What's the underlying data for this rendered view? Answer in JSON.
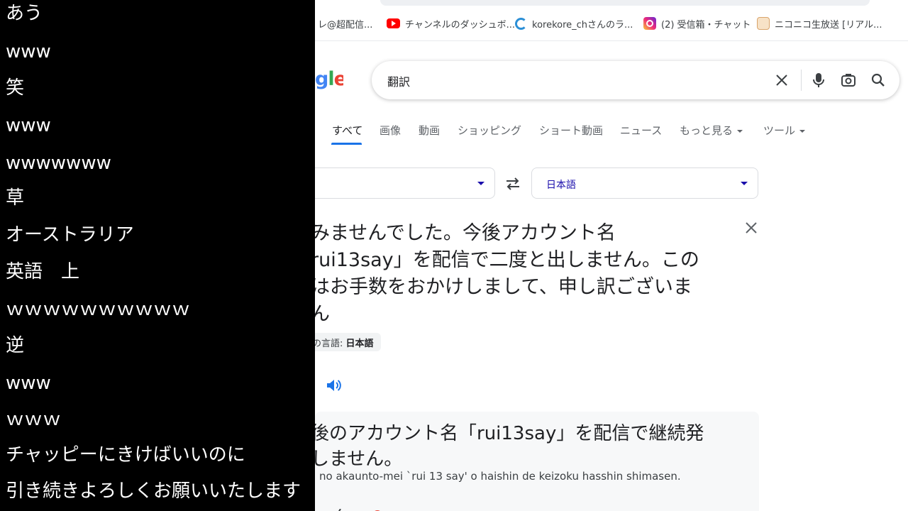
{
  "comments": [
    "あう",
    "www",
    "笑",
    "www",
    "wwwwwww",
    "草",
    "オーストラリア",
    "英語　上",
    "ｗｗｗｗｗｗｗｗｗｗ",
    "逆",
    "www",
    "ｗｗｗ",
    "チャッピーにきけばいいのに",
    "引き続きよろしくお願いいたします"
  ],
  "bookmarks": [
    {
      "label": "レ@超配信...",
      "icon": "nico-icon"
    },
    {
      "label": "チャンネルのダッシュボ...",
      "icon": "youtube-icon"
    },
    {
      "label": "korekore_chさんのラ...",
      "icon": "ring-icon"
    },
    {
      "label": "(2) 受信箱・チャット",
      "icon": "instagram-icon"
    },
    {
      "label": "ニコニコ生放送 [リアル...",
      "icon": "niconico-icon"
    }
  ],
  "google": {
    "logo_fragment": "gle",
    "search_query": "翻訳",
    "tabs": [
      "すべて",
      "画像",
      "動画",
      "ショッピング",
      "ショート動画",
      "ニュース",
      "もっと見る",
      "ツール"
    ],
    "active_tab": "すべて"
  },
  "translate": {
    "target_language": "日本語",
    "source_lines": [
      "みませんでした。今後アカウント名",
      "rui13say」を配信で二度と出しません。この",
      "はお手数をおかけしまして、申し訳ございま",
      "ん"
    ],
    "detected_label": "の言語:",
    "detected_value": "日本語",
    "result_lines": [
      "後のアカウント名「rui13say」を配信で継続発",
      "しません。"
    ],
    "romanization": "no akaunto-mei `rui 13 say' o haishin de keizoku hasshin shimasen."
  },
  "colors": {
    "accent": "#1a73e8",
    "link": "#1a0dab",
    "overlay_bg": "#000000"
  }
}
